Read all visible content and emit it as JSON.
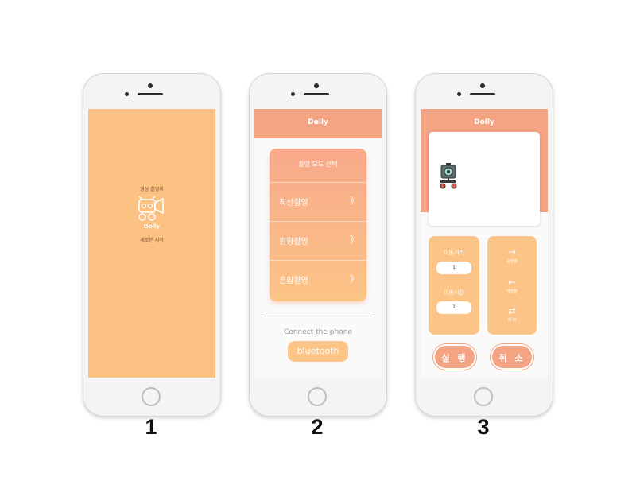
{
  "screen1": {
    "tagline_top": "영상 촬영의",
    "brand": "Dolly",
    "tagline_bottom": "새로운 시작"
  },
  "screen2": {
    "app_title": "Dolly",
    "card_title": "촬영 모드 선택",
    "modes": [
      {
        "label": "직선촬영",
        "chevron": "》"
      },
      {
        "label": "원형촬영",
        "chevron": "》"
      },
      {
        "label": "혼합촬영",
        "chevron": "》"
      }
    ],
    "connect_text": "Connect the phone",
    "bluetooth_label": "bluetooth"
  },
  "screen3": {
    "app_title": "Dolly",
    "distance_label": "이동거리",
    "distance_value": "1",
    "time_label": "이동시간",
    "time_value": "1",
    "directions": [
      {
        "arrow": "→",
        "label": "순방향"
      },
      {
        "arrow": "←",
        "label": "역방향"
      },
      {
        "arrow": "⇄",
        "label": "왕 복"
      }
    ],
    "run_label": "실 행",
    "cancel_label": "취 소"
  },
  "labels": [
    "1",
    "2",
    "3"
  ],
  "colors": {
    "splash": "#fcc283",
    "header": "#f4a383",
    "accent": "#fcc486",
    "button": "#f4a383"
  }
}
